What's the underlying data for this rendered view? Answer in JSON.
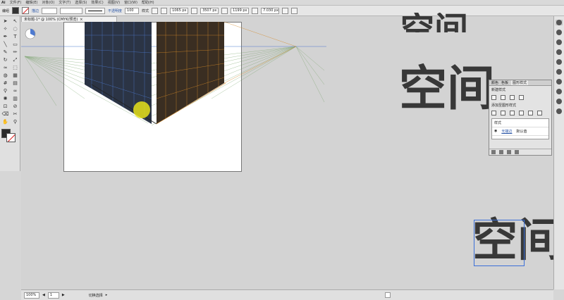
{
  "menu": {
    "logo": "Ai",
    "items": [
      "文件(F)",
      "编辑(E)",
      "对象(O)",
      "文字(T)",
      "选择(S)",
      "效果(C)",
      "视图(V)",
      "窗口(W)",
      "帮助(H)"
    ]
  },
  "control": {
    "selection_label": "编组",
    "stroke_label": "描边",
    "opacity_label": "不透明度",
    "opacity_value": "100",
    "style_label": "样式",
    "x_value": "1065 px",
    "y_value": "3507 px",
    "w_value": "1199 px",
    "h_value": "7.030 px"
  },
  "document": {
    "tab_title": "未标题-1* @ 100% (CMYK/预览)",
    "zoom": "100%",
    "page": "1",
    "status": "切换选择"
  },
  "canvas_text": {
    "top_partial": "空间",
    "middle": "空间",
    "bottom": "空间"
  },
  "graphic_styles_panel": {
    "tabs": [
      "颜色",
      "色板",
      "图形样式"
    ],
    "row1": "新建样式",
    "row2": "添加至图形样式",
    "list_header": "样式",
    "item_link": "无描边",
    "item_value": "默认值"
  },
  "colors": {
    "accent": "#3a6fd8",
    "canvas": "#d3d3d3",
    "text_dark": "#383838",
    "grid_green": "#6a9a5a",
    "grid_blue": "#4e7ad0",
    "grid_orange": "#d48a2a",
    "highlight_yellow": "#e6e21a"
  }
}
